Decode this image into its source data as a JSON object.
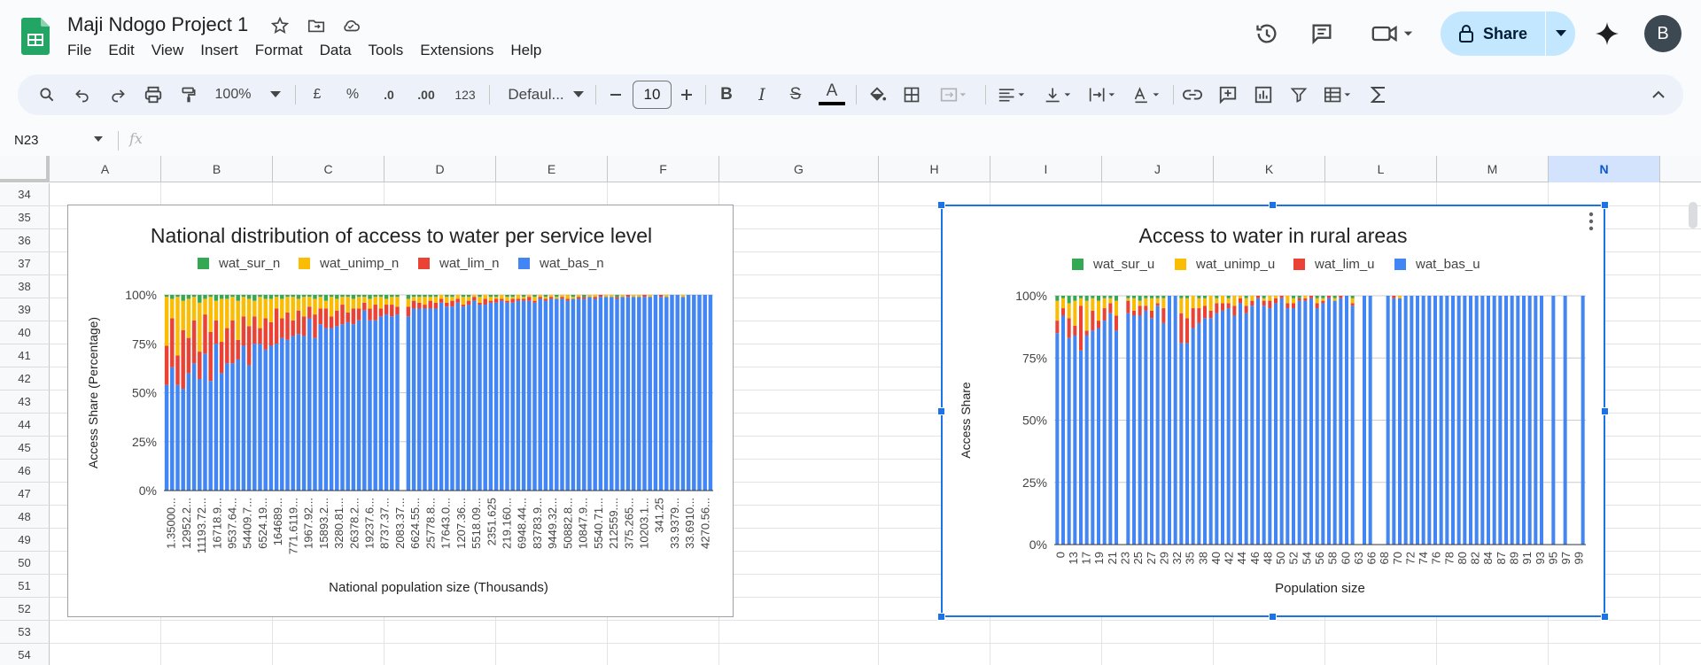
{
  "app": {
    "doc_title": "Maji Ndogo Project 1",
    "menu": [
      "File",
      "Edit",
      "View",
      "Insert",
      "Format",
      "Data",
      "Tools",
      "Extensions",
      "Help"
    ],
    "share_label": "Share",
    "avatar_letter": "B"
  },
  "toolbar": {
    "zoom": "100%",
    "currency": "£",
    "percent": "%",
    "dec_decrease": ".0",
    "dec_increase": ".00",
    "number_format": "123",
    "font_name": "Defaul...",
    "font_size": "10",
    "bold": "B",
    "italic": "I",
    "strike": "S",
    "text_color": "A"
  },
  "formula_bar": {
    "cell_ref": "N23",
    "fx": "fx"
  },
  "grid": {
    "columns": [
      "A",
      "B",
      "C",
      "D",
      "E",
      "F",
      "G",
      "H",
      "I",
      "J",
      "K",
      "L",
      "M",
      "N"
    ],
    "selected_column": "N",
    "rows": [
      "34",
      "35",
      "36",
      "37",
      "38",
      "39",
      "40",
      "41",
      "42",
      "43",
      "44",
      "45",
      "46",
      "47",
      "48",
      "49",
      "50",
      "51",
      "52",
      "53",
      "54"
    ]
  },
  "chart_data": [
    {
      "type": "bar",
      "stacked": true,
      "title": "National distribution of access to water per service level",
      "xlabel": "National population size (Thousands)",
      "ylabel": "Access Share (Percentage)",
      "ylim": [
        0,
        100
      ],
      "y_ticks": [
        "0%",
        "25%",
        "50%",
        "75%",
        "100%"
      ],
      "legend_position": "top",
      "x_tick_labels": [
        "1.35000...",
        "12952.2...",
        "11193.72...",
        "16718.9...",
        "9537.64...",
        "54409.7...",
        "6524.19...",
        "164689...",
        "771.6119...",
        "1967.92...",
        "15893.2...",
        "3280.81...",
        "26378.2...",
        "19237.6...",
        "8737.37...",
        "2083.37...",
        "6624.55...",
        "25778.8...",
        "17643.0...",
        "1207.36...",
        "5518.09...",
        "2351.625",
        "219.160...",
        "6948.44...",
        "83783.9...",
        "9449.32...",
        "50882.8...",
        "10847.9...",
        "5540.71...",
        "212559....",
        "375.265...",
        "10203.1...",
        "341.25",
        "33.9379...",
        "33.6910...",
        "4270.56..."
      ],
      "series": [
        {
          "name": "wat_sur_n",
          "color": "#34a853",
          "values": [
            1,
            2,
            1,
            3,
            2,
            1,
            4,
            2,
            1,
            3,
            2,
            2,
            1,
            3,
            1,
            2,
            3,
            1,
            2,
            2,
            1,
            2,
            1,
            1,
            2,
            1,
            1,
            2,
            1,
            3,
            1,
            2,
            1,
            1,
            2,
            1,
            1,
            2,
            1,
            1,
            2,
            1,
            1,
            1,
            2,
            1,
            1,
            1,
            1,
            1,
            0,
            1,
            1,
            0,
            1,
            1,
            0,
            1,
            0,
            1,
            1,
            0,
            1,
            1,
            0,
            1,
            0,
            1,
            0,
            1,
            0,
            1,
            0,
            0,
            1,
            0,
            1,
            0,
            0,
            0,
            0,
            0,
            1,
            0,
            0,
            0,
            0,
            0,
            0,
            0,
            0,
            0,
            0,
            0,
            0,
            0,
            0,
            0,
            0,
            0
          ]
        },
        {
          "name": "wat_unimp_n",
          "color": "#fbbc04",
          "values": [
            25,
            10,
            30,
            15,
            20,
            12,
            25,
            8,
            18,
            10,
            22,
            15,
            12,
            20,
            10,
            14,
            8,
            16,
            10,
            12,
            6,
            10,
            8,
            12,
            6,
            10,
            5,
            8,
            6,
            4,
            10,
            6,
            4,
            8,
            5,
            6,
            3,
            5,
            4,
            6,
            3,
            4,
            5,
            3,
            4,
            2,
            3,
            4,
            2,
            3,
            2,
            3,
            2,
            2,
            4,
            2,
            1,
            3,
            2,
            2,
            1,
            2,
            2,
            1,
            2,
            1,
            1,
            2,
            1,
            1,
            1,
            1,
            1,
            2,
            1,
            1,
            0,
            1,
            1,
            0,
            1,
            1,
            0,
            1,
            0,
            1,
            1,
            0,
            1,
            0,
            0,
            1,
            0,
            0,
            1,
            0,
            0,
            0,
            0,
            0
          ]
        },
        {
          "name": "wat_lim_n",
          "color": "#ea4335",
          "values": [
            20,
            25,
            15,
            30,
            18,
            22,
            14,
            20,
            25,
            12,
            16,
            18,
            22,
            10,
            15,
            20,
            14,
            8,
            16,
            12,
            18,
            10,
            14,
            8,
            12,
            10,
            6,
            12,
            8,
            10,
            6,
            8,
            10,
            5,
            8,
            6,
            4,
            6,
            8,
            4,
            5,
            6,
            4,
            3,
            5,
            4,
            3,
            2,
            4,
            3,
            2,
            2,
            3,
            2,
            1,
            2,
            2,
            1,
            3,
            1,
            2,
            1,
            1,
            2,
            1,
            1,
            2,
            1,
            1,
            1,
            1,
            0,
            1,
            1,
            0,
            1,
            1,
            0,
            1,
            1,
            0,
            0,
            1,
            0,
            1,
            0,
            0,
            1,
            0,
            0,
            1,
            0,
            0,
            0,
            0,
            0,
            0,
            0,
            0,
            0
          ]
        },
        {
          "name": "wat_bas_n",
          "color": "#4285f4",
          "values": [
            54,
            63,
            54,
            52,
            60,
            65,
            57,
            70,
            56,
            75,
            60,
            65,
            65,
            67,
            74,
            64,
            75,
            75,
            72,
            74,
            75,
            78,
            77,
            79,
            80,
            79,
            88,
            78,
            85,
            83,
            83,
            84,
            85,
            86,
            85,
            87,
            92,
            87,
            87,
            89,
            90,
            89,
            90,
            93,
            89,
            93,
            93,
            93,
            93,
            93,
            96,
            94,
            94,
            96,
            94,
            95,
            97,
            95,
            95,
            96,
            96,
            97,
            96,
            96,
            97,
            97,
            97,
            96,
            98,
            97,
            98,
            98,
            98,
            97,
            98,
            98,
            98,
            99,
            98,
            99,
            99,
            99,
            98,
            99,
            99,
            99,
            99,
            99,
            99,
            100,
            99,
            99,
            100,
            100,
            99,
            100,
            100,
            100,
            100,
            100
          ]
        }
      ]
    },
    {
      "type": "bar",
      "stacked": true,
      "title": "Access to water in rural areas",
      "xlabel": "Population size",
      "ylabel": "Access Share",
      "ylim": [
        0,
        100
      ],
      "y_ticks": [
        "0%",
        "25%",
        "50%",
        "75%",
        "100%"
      ],
      "legend_position": "top",
      "x_tick_labels": [
        "0",
        "13",
        "17",
        "19",
        "21",
        "23",
        "25",
        "27",
        "29",
        "32",
        "35",
        "38",
        "40",
        "42",
        "44",
        "46",
        "48",
        "50",
        "52",
        "54",
        "56",
        "58",
        "60",
        "63",
        "66",
        "68",
        "70",
        "72",
        "74",
        "76",
        "78",
        "80",
        "82",
        "84",
        "87",
        "89",
        "91",
        "93",
        "95",
        "97",
        "99"
      ],
      "series": [
        {
          "name": "wat_sur_u",
          "color": "#34a853",
          "values": [
            2,
            1,
            3,
            2,
            1,
            2,
            1,
            2,
            1,
            1,
            2,
            1,
            1,
            1,
            2,
            1,
            1,
            1,
            1,
            0,
            0,
            1,
            1,
            0,
            1,
            1,
            0,
            1,
            0,
            1,
            0,
            0,
            1,
            0,
            0,
            1,
            0,
            0,
            0,
            0,
            1,
            1,
            0,
            0,
            1,
            1,
            0,
            1,
            0,
            0,
            1,
            0,
            0,
            0,
            1,
            0,
            0,
            0,
            0,
            0,
            0,
            0,
            0,
            0,
            0,
            0,
            0,
            0,
            0,
            0,
            0,
            0,
            0,
            0,
            0,
            0,
            0,
            0,
            0,
            0,
            0,
            0,
            0,
            0,
            0,
            0,
            0,
            0,
            0,
            0
          ]
        },
        {
          "name": "wat_unimp_u",
          "color": "#fbbc04",
          "values": [
            8,
            4,
            6,
            10,
            3,
            12,
            5,
            8,
            4,
            2,
            6,
            3,
            1,
            5,
            2,
            3,
            5,
            2,
            4,
            0,
            0,
            6,
            8,
            5,
            4,
            3,
            6,
            2,
            3,
            2,
            4,
            1,
            3,
            2,
            0,
            1,
            2,
            1,
            0,
            3,
            2,
            0,
            1,
            0,
            2,
            1,
            0,
            1,
            0,
            0,
            2,
            1,
            0,
            0,
            1,
            0,
            0,
            0,
            1,
            0,
            0,
            0,
            0,
            0,
            0,
            0,
            0,
            0,
            0,
            0,
            0,
            0,
            0,
            0,
            0,
            0,
            0,
            0,
            0,
            0,
            0,
            0,
            0,
            0,
            0,
            0,
            0,
            0,
            0,
            0
          ]
        },
        {
          "name": "wat_lim_u",
          "color": "#ea4335",
          "values": [
            5,
            3,
            8,
            4,
            18,
            2,
            8,
            3,
            5,
            4,
            6,
            3,
            5,
            2,
            4,
            2,
            3,
            1,
            6,
            0,
            0,
            12,
            10,
            8,
            6,
            5,
            3,
            4,
            3,
            2,
            4,
            2,
            3,
            2,
            1,
            2,
            3,
            2,
            1,
            2,
            2,
            1,
            1,
            1,
            2,
            1,
            1,
            0,
            1,
            0,
            1,
            1,
            0,
            0,
            0,
            0,
            0,
            1,
            0,
            0,
            0,
            0,
            0,
            0,
            0,
            0,
            0,
            0,
            0,
            0,
            0,
            0,
            0,
            0,
            0,
            0,
            0,
            0,
            0,
            0,
            0,
            0,
            0,
            0,
            0,
            0,
            0,
            0,
            0,
            0
          ]
        },
        {
          "name": "wat_bas_u",
          "color": "#4285f4",
          "values": [
            85,
            92,
            83,
            84,
            78,
            84,
            86,
            87,
            90,
            93,
            86,
            93,
            93,
            92,
            92,
            94,
            91,
            96,
            89,
            100,
            100,
            81,
            81,
            87,
            89,
            91,
            91,
            93,
            94,
            95,
            92,
            97,
            93,
            96,
            99,
            96,
            95,
            97,
            99,
            95,
            95,
            98,
            98,
            99,
            95,
            97,
            99,
            98,
            99,
            100,
            96,
            98,
            100,
            100,
            98,
            100,
            100,
            99,
            99,
            100,
            100,
            100,
            100,
            100,
            100,
            100,
            100,
            100,
            100,
            100,
            100,
            100,
            100,
            100,
            100,
            100,
            100,
            100,
            100,
            100,
            100,
            100,
            100,
            100,
            100,
            100,
            100,
            100,
            100,
            100
          ]
        }
      ]
    }
  ]
}
